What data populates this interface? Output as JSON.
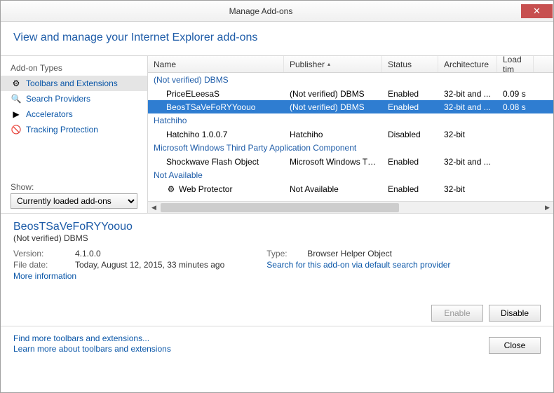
{
  "window": {
    "title": "Manage Add-ons"
  },
  "header": {
    "title": "View and manage your Internet Explorer add-ons"
  },
  "sidebar": {
    "label": "Add-on Types",
    "items": [
      {
        "label": "Toolbars and Extensions",
        "icon": "⚙"
      },
      {
        "label": "Search Providers",
        "icon": "🔍"
      },
      {
        "label": "Accelerators",
        "icon": "▶"
      },
      {
        "label": "Tracking Protection",
        "icon": "🚫"
      }
    ],
    "show_label": "Show:",
    "show_value": "Currently loaded add-ons"
  },
  "table": {
    "columns": {
      "name": "Name",
      "publisher": "Publisher",
      "status": "Status",
      "arch": "Architecture",
      "load": "Load tim"
    },
    "groups": [
      {
        "label": "(Not verified) DBMS",
        "rows": [
          {
            "name": "PriceELeesaS",
            "publisher": "(Not verified) DBMS",
            "status": "Enabled",
            "arch": "32-bit and ...",
            "load": "0.09 s",
            "selected": false,
            "icon": ""
          },
          {
            "name": "BeosTSaVeFoRYYoouo",
            "publisher": "(Not verified) DBMS",
            "status": "Enabled",
            "arch": "32-bit and ...",
            "load": "0.08 s",
            "selected": true,
            "icon": ""
          }
        ]
      },
      {
        "label": "Hatchiho",
        "rows": [
          {
            "name": "Hatchiho 1.0.0.7",
            "publisher": "Hatchiho",
            "status": "Disabled",
            "arch": "32-bit",
            "load": "",
            "icon": ""
          }
        ]
      },
      {
        "label": "Microsoft Windows Third Party Application Component",
        "rows": [
          {
            "name": "Shockwave Flash Object",
            "publisher": "Microsoft Windows Thir...",
            "status": "Enabled",
            "arch": "32-bit and ...",
            "load": "",
            "icon": ""
          }
        ]
      },
      {
        "label": "Not Available",
        "rows": [
          {
            "name": "Web Protector",
            "publisher": "Not Available",
            "status": "Enabled",
            "arch": "32-bit",
            "load": "",
            "icon": "⚙"
          }
        ]
      }
    ]
  },
  "details": {
    "name": "BeosTSaVeFoRYYoouo",
    "sub": "(Not verified) DBMS",
    "version_label": "Version:",
    "version": "4.1.0.0",
    "filedate_label": "File date:",
    "filedate": "Today, ‎August ‎12, ‎2015, 33 minutes ago",
    "type_label": "Type:",
    "type": "Browser Helper Object",
    "search_link": "Search for this add-on via default search provider",
    "more_info": "More information"
  },
  "actions": {
    "enable": "Enable",
    "disable": "Disable"
  },
  "footer": {
    "link1": "Find more toolbars and extensions...",
    "link2": "Learn more about toolbars and extensions",
    "close": "Close"
  }
}
